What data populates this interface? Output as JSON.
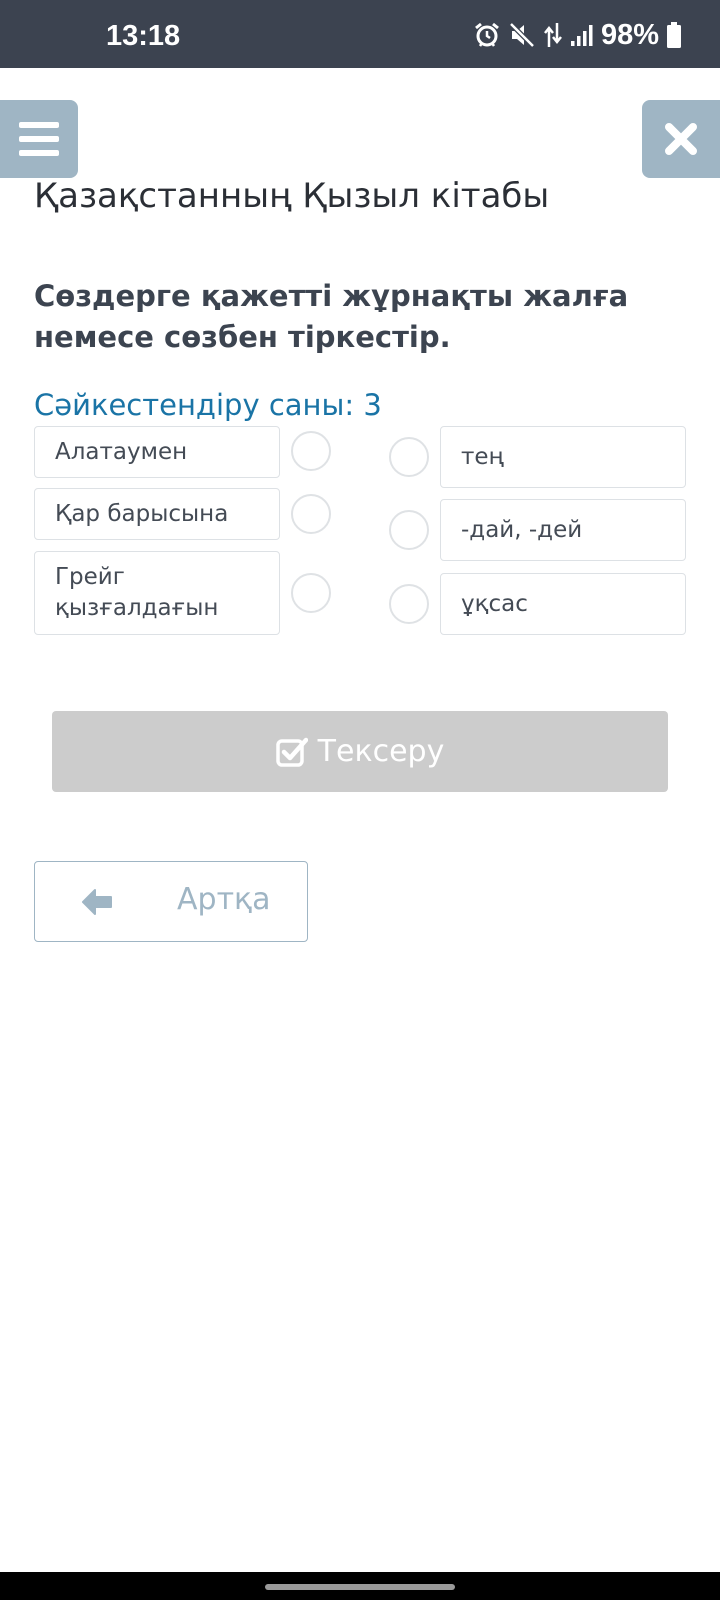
{
  "status_bar": {
    "time": "13:18",
    "battery": "98%",
    "icons": [
      "alarm-icon",
      "mute-icon",
      "data-arrows-icon",
      "signal-icon",
      "battery-icon"
    ]
  },
  "header": {
    "menu_icon": "hamburger-menu-icon",
    "close_icon": "close-x-icon"
  },
  "page_title": "Қазақстанның Қызыл кітабы",
  "question": "Сөздерге қажетті жұрнақты жалға немесе сөзбен тіркестір.",
  "match_count": "Сәйкестендіру саны: 3",
  "left_items": [
    {
      "label": "Алатаумен"
    },
    {
      "label": "Қар барысына"
    },
    {
      "label": "Грейг қызғалдағын"
    }
  ],
  "right_items": [
    {
      "label": "тең"
    },
    {
      "label": "-дай, -дей"
    },
    {
      "label": "ұқсас"
    }
  ],
  "check_button": {
    "label": "Тексеру",
    "icon": "check-square-icon"
  },
  "back_button": {
    "label": "Артқа",
    "icon": "arrow-left-icon"
  },
  "colors": {
    "status_bar": "#3c4350",
    "accent_blue_gray": "#9fb5c4",
    "match_count_text": "#1a74a6",
    "disabled_button": "#cccccc"
  }
}
